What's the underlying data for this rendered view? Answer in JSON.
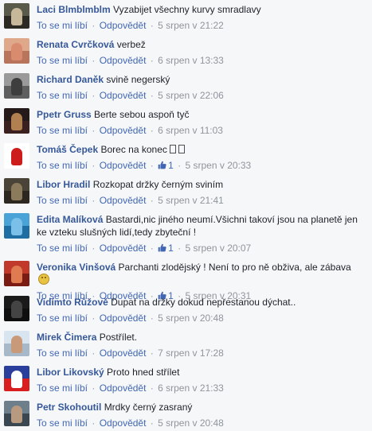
{
  "actions": {
    "like": "To se mi líbí",
    "reply": "Odpovědět",
    "sep": "·"
  },
  "comments": [
    {
      "name": "Laci Blmblmblm",
      "text": "Vyzabijet všechny kurvy smradlavy",
      "time": "5 srpen v 21:22",
      "likes": null,
      "avatar": [
        "#5a5a4a",
        "#2d2a24",
        "#c7b89a"
      ]
    },
    {
      "name": "Renata Cvrčková",
      "text": "verbež",
      "time": "6 srpen v 13:33",
      "likes": null,
      "avatar": [
        "#e0a88a",
        "#b9755c",
        "#d98b70"
      ]
    },
    {
      "name": "Richard Daněk",
      "text": "svině negerský",
      "time": "5 srpen v 22:06",
      "likes": null,
      "avatar": [
        "#9a9a9a",
        "#5f5f5f",
        "#3e3e3e"
      ]
    },
    {
      "name": "Ppetr Gruss",
      "text": "Berte sebou aspoň tyč",
      "time": "6 srpen v 11:03",
      "likes": null,
      "avatar": [
        "#241a1a",
        "#3b2020",
        "#b08050"
      ]
    },
    {
      "name": "Tomáš Čepek",
      "text": "Borec na konec",
      "time": "5 srpen v 20:33",
      "likes": "1",
      "avatar": [
        "#ffffff",
        "#ffffff",
        "#cc1c1c"
      ],
      "boxes": true
    },
    {
      "name": "Libor Hradil",
      "text": "Rozkopat držky černým sviním",
      "time": "5 srpen v 21:41",
      "likes": null,
      "avatar": [
        "#4a4438",
        "#2c2820",
        "#8c7a5c"
      ]
    },
    {
      "name": "Edita Malíková",
      "text": "Bastardi,nic jiného neumí.Všichni takoví jsou na planetě jen ke vzteku slušných lidí,tedy zbyteční !",
      "time": "5 srpen v 20:07",
      "likes": "1",
      "avatar": [
        "#4aa3d6",
        "#1e6ea3",
        "#7ac0e8"
      ]
    },
    {
      "name": "Veronika Vinšová",
      "text": "Parchanti zlodějský ! Není to pro ně obživa, ale zábava",
      "time": "5 srpen v 20:31",
      "likes": "1",
      "avatar": [
        "#c0392b",
        "#7a1c14",
        "#e07a50"
      ],
      "emoji": true
    },
    {
      "name": "Vidímto Růžově",
      "text": "Dupat na držky dokud nepřestanou dýchat..",
      "time": "5 srpen v 20:48",
      "likes": null,
      "avatar": [
        "#1a1a1a",
        "#0f0f0f",
        "#444444"
      ]
    },
    {
      "name": "Mirek Čimera",
      "text": "Postřílet.",
      "time": "7 srpen v 17:28",
      "likes": null,
      "avatar": [
        "#d8e4ef",
        "#a7b8c8",
        "#c99a7a"
      ]
    },
    {
      "name": "Libor Likovský",
      "text": "Proto hned střílet",
      "time": "6 srpen v 21:33",
      "likes": null,
      "avatar": [
        "#2a3f9b",
        "#d81e1e",
        "#ffffff"
      ]
    },
    {
      "name": "Petr Skohoutil",
      "text": "Mrdky černý zasraný",
      "time": "5 srpen v 20:48",
      "likes": null,
      "avatar": [
        "#6e7f8c",
        "#3a4650",
        "#b89a80"
      ]
    }
  ]
}
